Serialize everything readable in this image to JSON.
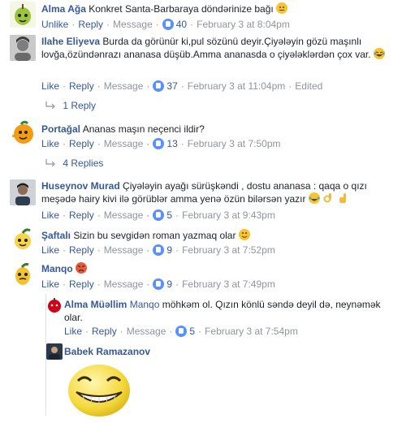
{
  "comments": [
    {
      "author": "Alma Ağa",
      "text": "Konkret Santa-Barbaraya döndərinize bağı",
      "actions": {
        "unlike": "Unlike",
        "reply": "Reply",
        "message": "Message"
      },
      "likes": "40",
      "time": "February 3 at 8:04pm"
    },
    {
      "author": "Ilahe Eliyeva",
      "text": "Burda da görünür ki,pul sözünü deyir.Çiyələyin gözü maşınlı lovğa,özündənrazı ananasa düşüb.Amma ananasda o çiyələklərdən çox var.",
      "actions": {
        "like": "Like",
        "reply": "Reply",
        "message": "Message"
      },
      "likes": "37",
      "time": "February 3 at 11:04pm",
      "edited": "Edited",
      "replies": "1 Reply"
    },
    {
      "author": "Portağal",
      "text": "Ananas maşın neçenci ildir?",
      "actions": {
        "like": "Like",
        "reply": "Reply",
        "message": "Message"
      },
      "likes": "13",
      "time": "February 3 at 7:50pm",
      "replies": "4 Replies"
    },
    {
      "author": "Huseynov Murad",
      "text": "Çiyələyin ayağı sürüşkəndi , dostu ananasa : qaqa o qızı meşədə hairy kivi ilə görüblər amma yenə özün bilərsən yazır",
      "actions": {
        "like": "Like",
        "reply": "Reply",
        "message": "Message"
      },
      "likes": "5",
      "time": "February 3 at 9:43pm"
    },
    {
      "author": "Şaftalı",
      "text": "Sizin bu sevgidən roman yazmaq olar",
      "actions": {
        "like": "Like",
        "reply": "Reply",
        "message": "Message"
      },
      "likes": "9",
      "time": "February 3 at 7:52pm"
    },
    {
      "author": "Manqo",
      "text": "",
      "actions": {
        "like": "Like",
        "reply": "Reply",
        "message": "Message"
      },
      "likes": "9",
      "time": "February 3 at 7:49pm"
    }
  ],
  "reply_thread": [
    {
      "author": "Alma Müəllim",
      "mention": "Manqo",
      "text": "möhkəm ol. Qızın könlü səndə deyil də, neynəmək olar.",
      "actions": {
        "like": "Like",
        "reply": "Reply",
        "message": "Message"
      },
      "likes": "5",
      "time": "February 3 at 7:54pm"
    },
    {
      "author": "Babek Ramazanov"
    }
  ],
  "colors": {
    "link": "#365899",
    "meta": "#90949c",
    "like_badge": "#5890ff",
    "emoji": "#f7c331"
  },
  "icons": {
    "like": "thumbs-up-icon",
    "reply_arrow": "reply-arrow-icon"
  }
}
